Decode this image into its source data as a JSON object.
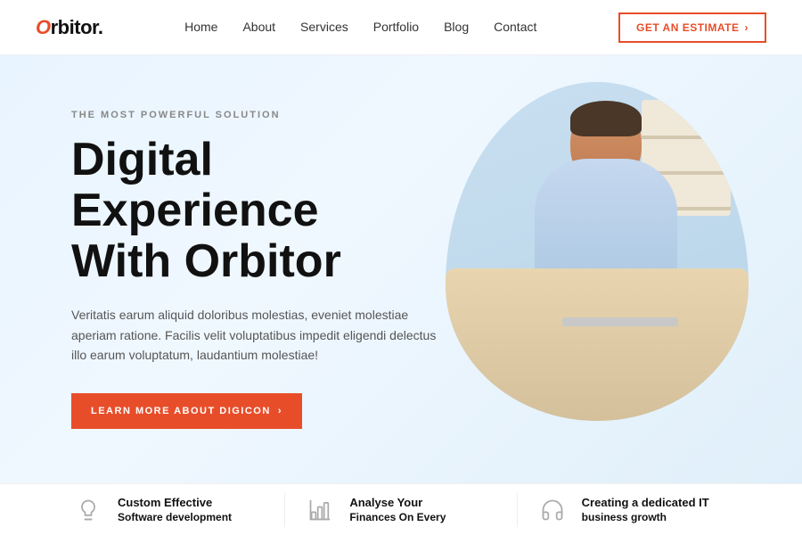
{
  "navbar": {
    "logo_prefix": "O",
    "logo_rest": "rbitor.",
    "links": [
      "Home",
      "About",
      "Services",
      "Portfolio",
      "Blog",
      "Contact"
    ],
    "cta_label": "GET AN ESTIMATE",
    "cta_arrow": "›"
  },
  "hero": {
    "subtitle": "THE MOST POWERFUL SOLUTION",
    "title_line1": "Digital Experience",
    "title_line2": "With Orbitor",
    "description": "Veritatis earum aliquid doloribus molestias, eveniet molestiae aperiam ratione. Facilis velit voluptatibus impedit eligendi delectus illo earum voluptatum, laudantium molestiae!",
    "cta_label": "LEARN MORE ABOUT DIGICON",
    "cta_arrow": "›"
  },
  "bottom_cards": [
    {
      "icon": "bulb",
      "title_line1": "Custom Effective",
      "title_line2": "Software development"
    },
    {
      "icon": "chart",
      "title_line1": "Analyse Your",
      "title_line2": "Finances On Every"
    },
    {
      "icon": "headset",
      "title_line1": "Creating a dedicated IT",
      "title_line2": "business growth"
    }
  ]
}
